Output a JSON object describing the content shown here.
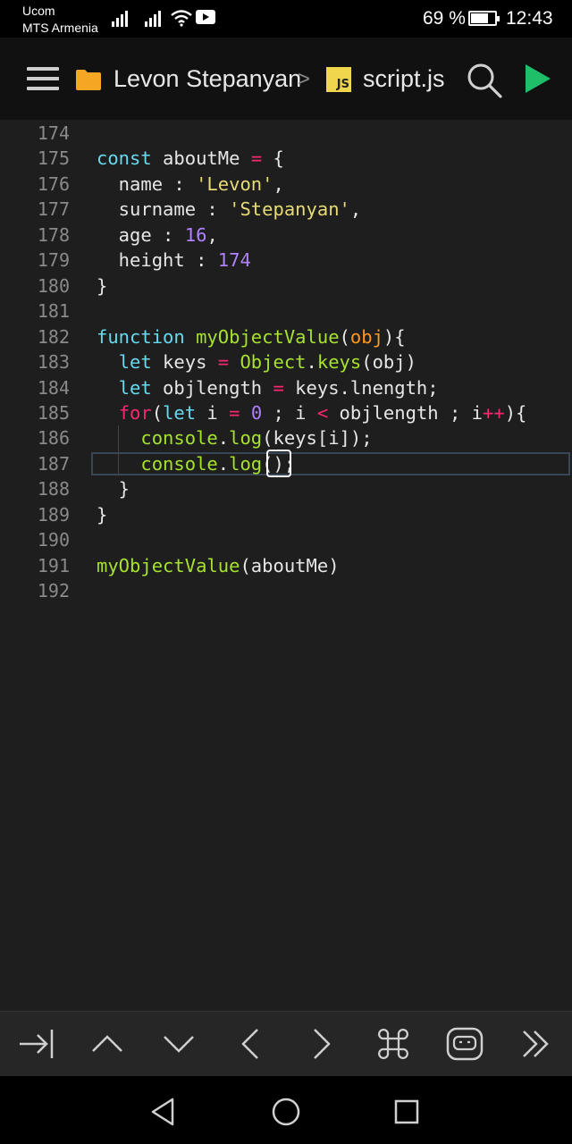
{
  "status_bar": {
    "carrier_line1": "Ucom",
    "carrier_line2": "MTS Armenia",
    "battery_percent": "69 %",
    "battery_level": 0.69,
    "time": "12:43"
  },
  "toolbar": {
    "breadcrumb_folder": "Levon Stepanyan",
    "breadcrumb_separator": ">",
    "file_badge": "JS",
    "breadcrumb_file": "script.js",
    "icons": [
      "menu-icon",
      "folder-icon",
      "js-file-icon",
      "search-icon",
      "run-icon"
    ]
  },
  "editor": {
    "lines": [
      {
        "n": "174",
        "tokens": []
      },
      {
        "n": "175",
        "tokens": [
          [
            "kw",
            "const"
          ],
          [
            "pl",
            " aboutMe "
          ],
          [
            "op",
            "="
          ],
          [
            "pl",
            " {"
          ]
        ]
      },
      {
        "n": "176",
        "tokens": [
          [
            "pl",
            "  name : "
          ],
          [
            "str",
            "'Levon'"
          ],
          [
            "pl",
            ","
          ]
        ]
      },
      {
        "n": "177",
        "tokens": [
          [
            "pl",
            "  surname : "
          ],
          [
            "str",
            "'Stepanyan'"
          ],
          [
            "pl",
            ","
          ]
        ]
      },
      {
        "n": "178",
        "tokens": [
          [
            "pl",
            "  age : "
          ],
          [
            "num",
            "16"
          ],
          [
            "pl",
            ","
          ]
        ]
      },
      {
        "n": "179",
        "tokens": [
          [
            "pl",
            "  height : "
          ],
          [
            "num",
            "174"
          ]
        ]
      },
      {
        "n": "180",
        "tokens": [
          [
            "pl",
            "}"
          ]
        ]
      },
      {
        "n": "181",
        "tokens": []
      },
      {
        "n": "182",
        "tokens": [
          [
            "kw",
            "function"
          ],
          [
            "pl",
            " "
          ],
          [
            "fn",
            "myObjectValue"
          ],
          [
            "pl",
            "("
          ],
          [
            "prm",
            "obj"
          ],
          [
            "pl",
            "){"
          ]
        ]
      },
      {
        "n": "183",
        "tokens": [
          [
            "pl",
            "  "
          ],
          [
            "kw",
            "let"
          ],
          [
            "pl",
            " keys "
          ],
          [
            "op",
            "="
          ],
          [
            "pl",
            " "
          ],
          [
            "fn",
            "Object"
          ],
          [
            "pl",
            "."
          ],
          [
            "fn",
            "keys"
          ],
          [
            "pl",
            "(obj)"
          ]
        ]
      },
      {
        "n": "184",
        "tokens": [
          [
            "pl",
            "  "
          ],
          [
            "kw",
            "let"
          ],
          [
            "pl",
            " objlength "
          ],
          [
            "op",
            "="
          ],
          [
            "pl",
            " keys.lnength;"
          ]
        ]
      },
      {
        "n": "185",
        "tokens": [
          [
            "pl",
            "  "
          ],
          [
            "op",
            "for"
          ],
          [
            "pl",
            "("
          ],
          [
            "kw",
            "let"
          ],
          [
            "pl",
            " i "
          ],
          [
            "op",
            "="
          ],
          [
            "pl",
            " "
          ],
          [
            "num",
            "0"
          ],
          [
            "pl",
            " ; i "
          ],
          [
            "op",
            "<"
          ],
          [
            "pl",
            " objlength ; i"
          ],
          [
            "op",
            "++"
          ],
          [
            "pl",
            "){"
          ]
        ]
      },
      {
        "n": "186",
        "tokens": [
          [
            "pl",
            "    "
          ],
          [
            "fn",
            "console"
          ],
          [
            "pl",
            "."
          ],
          [
            "fn",
            "log"
          ],
          [
            "pl",
            "(keys[i]);"
          ]
        ]
      },
      {
        "n": "187",
        "tokens": [
          [
            "pl",
            "    "
          ],
          [
            "fn",
            "console"
          ],
          [
            "pl",
            "."
          ],
          [
            "fn",
            "log"
          ],
          [
            "pl",
            "();"
          ]
        ]
      },
      {
        "n": "188",
        "tokens": [
          [
            "pl",
            "  }"
          ]
        ]
      },
      {
        "n": "189",
        "tokens": [
          [
            "pl",
            "}"
          ]
        ]
      },
      {
        "n": "190",
        "tokens": []
      },
      {
        "n": "191",
        "tokens": [
          [
            "fn",
            "myObjectValue"
          ],
          [
            "pl",
            "(aboutMe)"
          ]
        ]
      },
      {
        "n": "192",
        "tokens": []
      }
    ]
  },
  "keyboard_bar": {
    "icons": [
      "tab-icon",
      "arrow-up-icon",
      "arrow-down-icon",
      "arrow-left-icon",
      "arrow-right-icon",
      "command-icon",
      "assistant-icon",
      "fast-forward-icon"
    ]
  },
  "nav_bar": {
    "icons": [
      "back-icon",
      "home-icon",
      "recents-icon"
    ]
  },
  "colors": {
    "background": "#1e1e1e",
    "toolbar": "#111111",
    "keyword": "#66d9ef",
    "function": "#a6e22e",
    "string": "#e6db74",
    "number": "#ae81ff",
    "operator": "#f92672",
    "param": "#fd971f",
    "run_green": "#1fbf6a",
    "folder_orange": "#f5a623"
  }
}
